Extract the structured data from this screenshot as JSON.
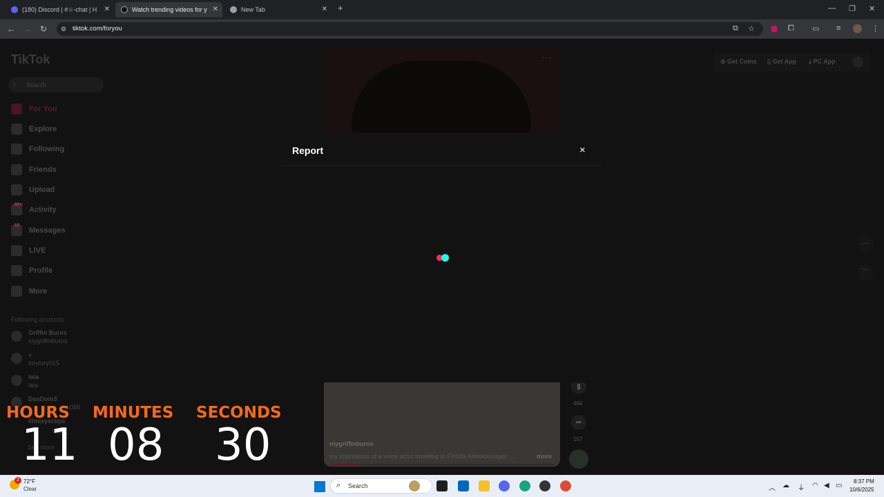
{
  "browser": {
    "tabs": [
      {
        "title": "(180) Discord | #☆-chat | H",
        "favicon_color": "#5865f2"
      },
      {
        "title": "Watch trending videos for y",
        "favicon_color": "#000000"
      },
      {
        "title": "New Tab",
        "favicon_color": "#9aa0a6"
      }
    ],
    "new_tab_label": "+",
    "url": "tiktok.com/foryou"
  },
  "tiktok": {
    "logo": "TikTok",
    "search_placeholder": "Search",
    "nav": [
      {
        "label": "For You",
        "active": true
      },
      {
        "label": "Explore"
      },
      {
        "label": "Following"
      },
      {
        "label": "Friends"
      },
      {
        "label": "Upload"
      },
      {
        "label": "Activity",
        "badge": "99+"
      },
      {
        "label": "Messages",
        "badge": "10"
      },
      {
        "label": "LIVE"
      },
      {
        "label": "Profile"
      },
      {
        "label": "More"
      }
    ],
    "following_title": "Following accounts",
    "accounts": [
      {
        "name": "Griffin Burns",
        "handle": "mygriffinburns"
      },
      {
        "name": "»",
        "handle": "torytory015"
      },
      {
        "name": "lala",
        "handle": "lala"
      },
      {
        "name": "DasDom3",
        "handle": "m385"
      },
      {
        "name": "lilmixyxclips",
        "handle": "clips_"
      }
    ],
    "see_more": "See more",
    "header": {
      "get_coins": "Get Coins",
      "get_app": "Get App",
      "pc_app": "PC App"
    },
    "video": {
      "username": "mygriffinburns",
      "caption": "my impression of a voice actor traveling to Florida #demonslayer ...",
      "more": "more",
      "bookmarks": "464",
      "shares": "157",
      "progress": 0.15
    }
  },
  "modal": {
    "title": "Report",
    "close": "×"
  },
  "countdown": {
    "hours_label": "HOURS",
    "minutes_label": "MINUTES",
    "seconds_label": "SECONDS",
    "hours": "11",
    "minutes": "08",
    "seconds": "30"
  },
  "taskbar": {
    "weather_temp": "72°F",
    "weather_cond": "Clear",
    "weather_badge": "2",
    "search": "Search",
    "time": "8:37 PM",
    "date": "10/6/2025"
  },
  "colors": {
    "accent_red": "#fe2c55",
    "accent_cyan": "#25f4ee",
    "countdown_label": "#f26a1b"
  }
}
